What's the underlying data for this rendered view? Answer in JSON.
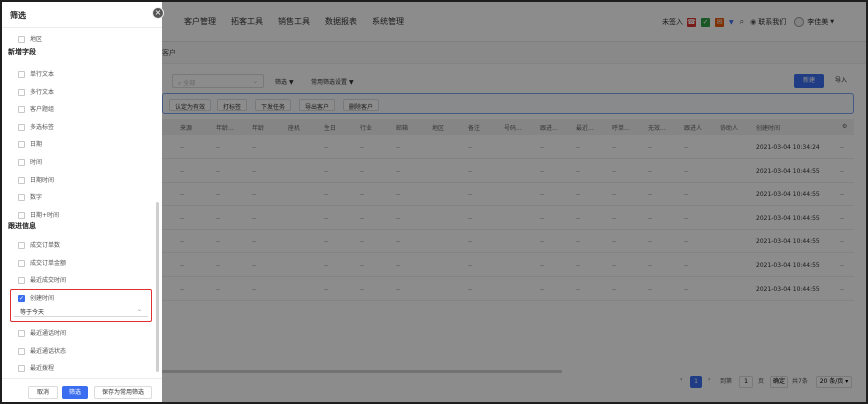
{
  "nav": {
    "items": [
      "客户管理",
      "拓客工具",
      "销售工具",
      "数据报表",
      "系统管理"
    ],
    "status_text": "未签入",
    "contact_label": "联系我们",
    "user_name": "李佳美"
  },
  "breadcrumb": "客户",
  "toolbar": {
    "search_placeholder": "全部",
    "filter_label": "筛选",
    "common_filter_label": "常用筛选设置",
    "new_button": "新建",
    "import_button": "导入"
  },
  "actions": [
    "认定为有效",
    "打标签",
    "下发任务",
    "导出客户",
    "删除客户"
  ],
  "table": {
    "columns": [
      "来源",
      "年龄...",
      "年龄",
      "座机",
      "生日",
      "行业",
      "邮箱",
      "地区",
      "备注",
      "号码...",
      "跟进...",
      "最近...",
      "呼单...",
      "无效...",
      "跟进人",
      "协助人",
      "创建时间"
    ],
    "rows": [
      {
        "time": "2021-03-04 10:34:24"
      },
      {
        "time": "2021-03-04 10:44:55"
      },
      {
        "time": "2021-03-04 10:44:55"
      },
      {
        "time": "2021-03-04 10:44:55"
      },
      {
        "time": "2021-03-04 10:44:55"
      },
      {
        "time": "2021-03-04 10:44:55"
      },
      {
        "time": "2021-03-04 10:44:55"
      }
    ],
    "dash": "--"
  },
  "pagination": {
    "current_page": "1",
    "goto_label": "到第",
    "goto_value": "1",
    "page_label": "页",
    "confirm": "确定",
    "total": "共7条",
    "per_page": "20 条/页"
  },
  "drawer": {
    "title": "筛选",
    "item_region": "地区",
    "section_new_fields": "新增字段",
    "new_fields": [
      "单行文本",
      "多行文本",
      "客户题组",
      "多选标签",
      "日期",
      "时间",
      "日期时间",
      "数字",
      "日期+时间"
    ],
    "section_followup": "跟进信息",
    "followup_items": [
      "成交订单数",
      "成交订单金额",
      "最近成交时间"
    ],
    "selected_item": "创建时间",
    "selected_value": "等于今天",
    "after_items": [
      "最近通话时间",
      "最近通话状态",
      "最近拨程"
    ],
    "cancel": "取消",
    "apply": "筛选",
    "save": "保存为常用筛选"
  }
}
